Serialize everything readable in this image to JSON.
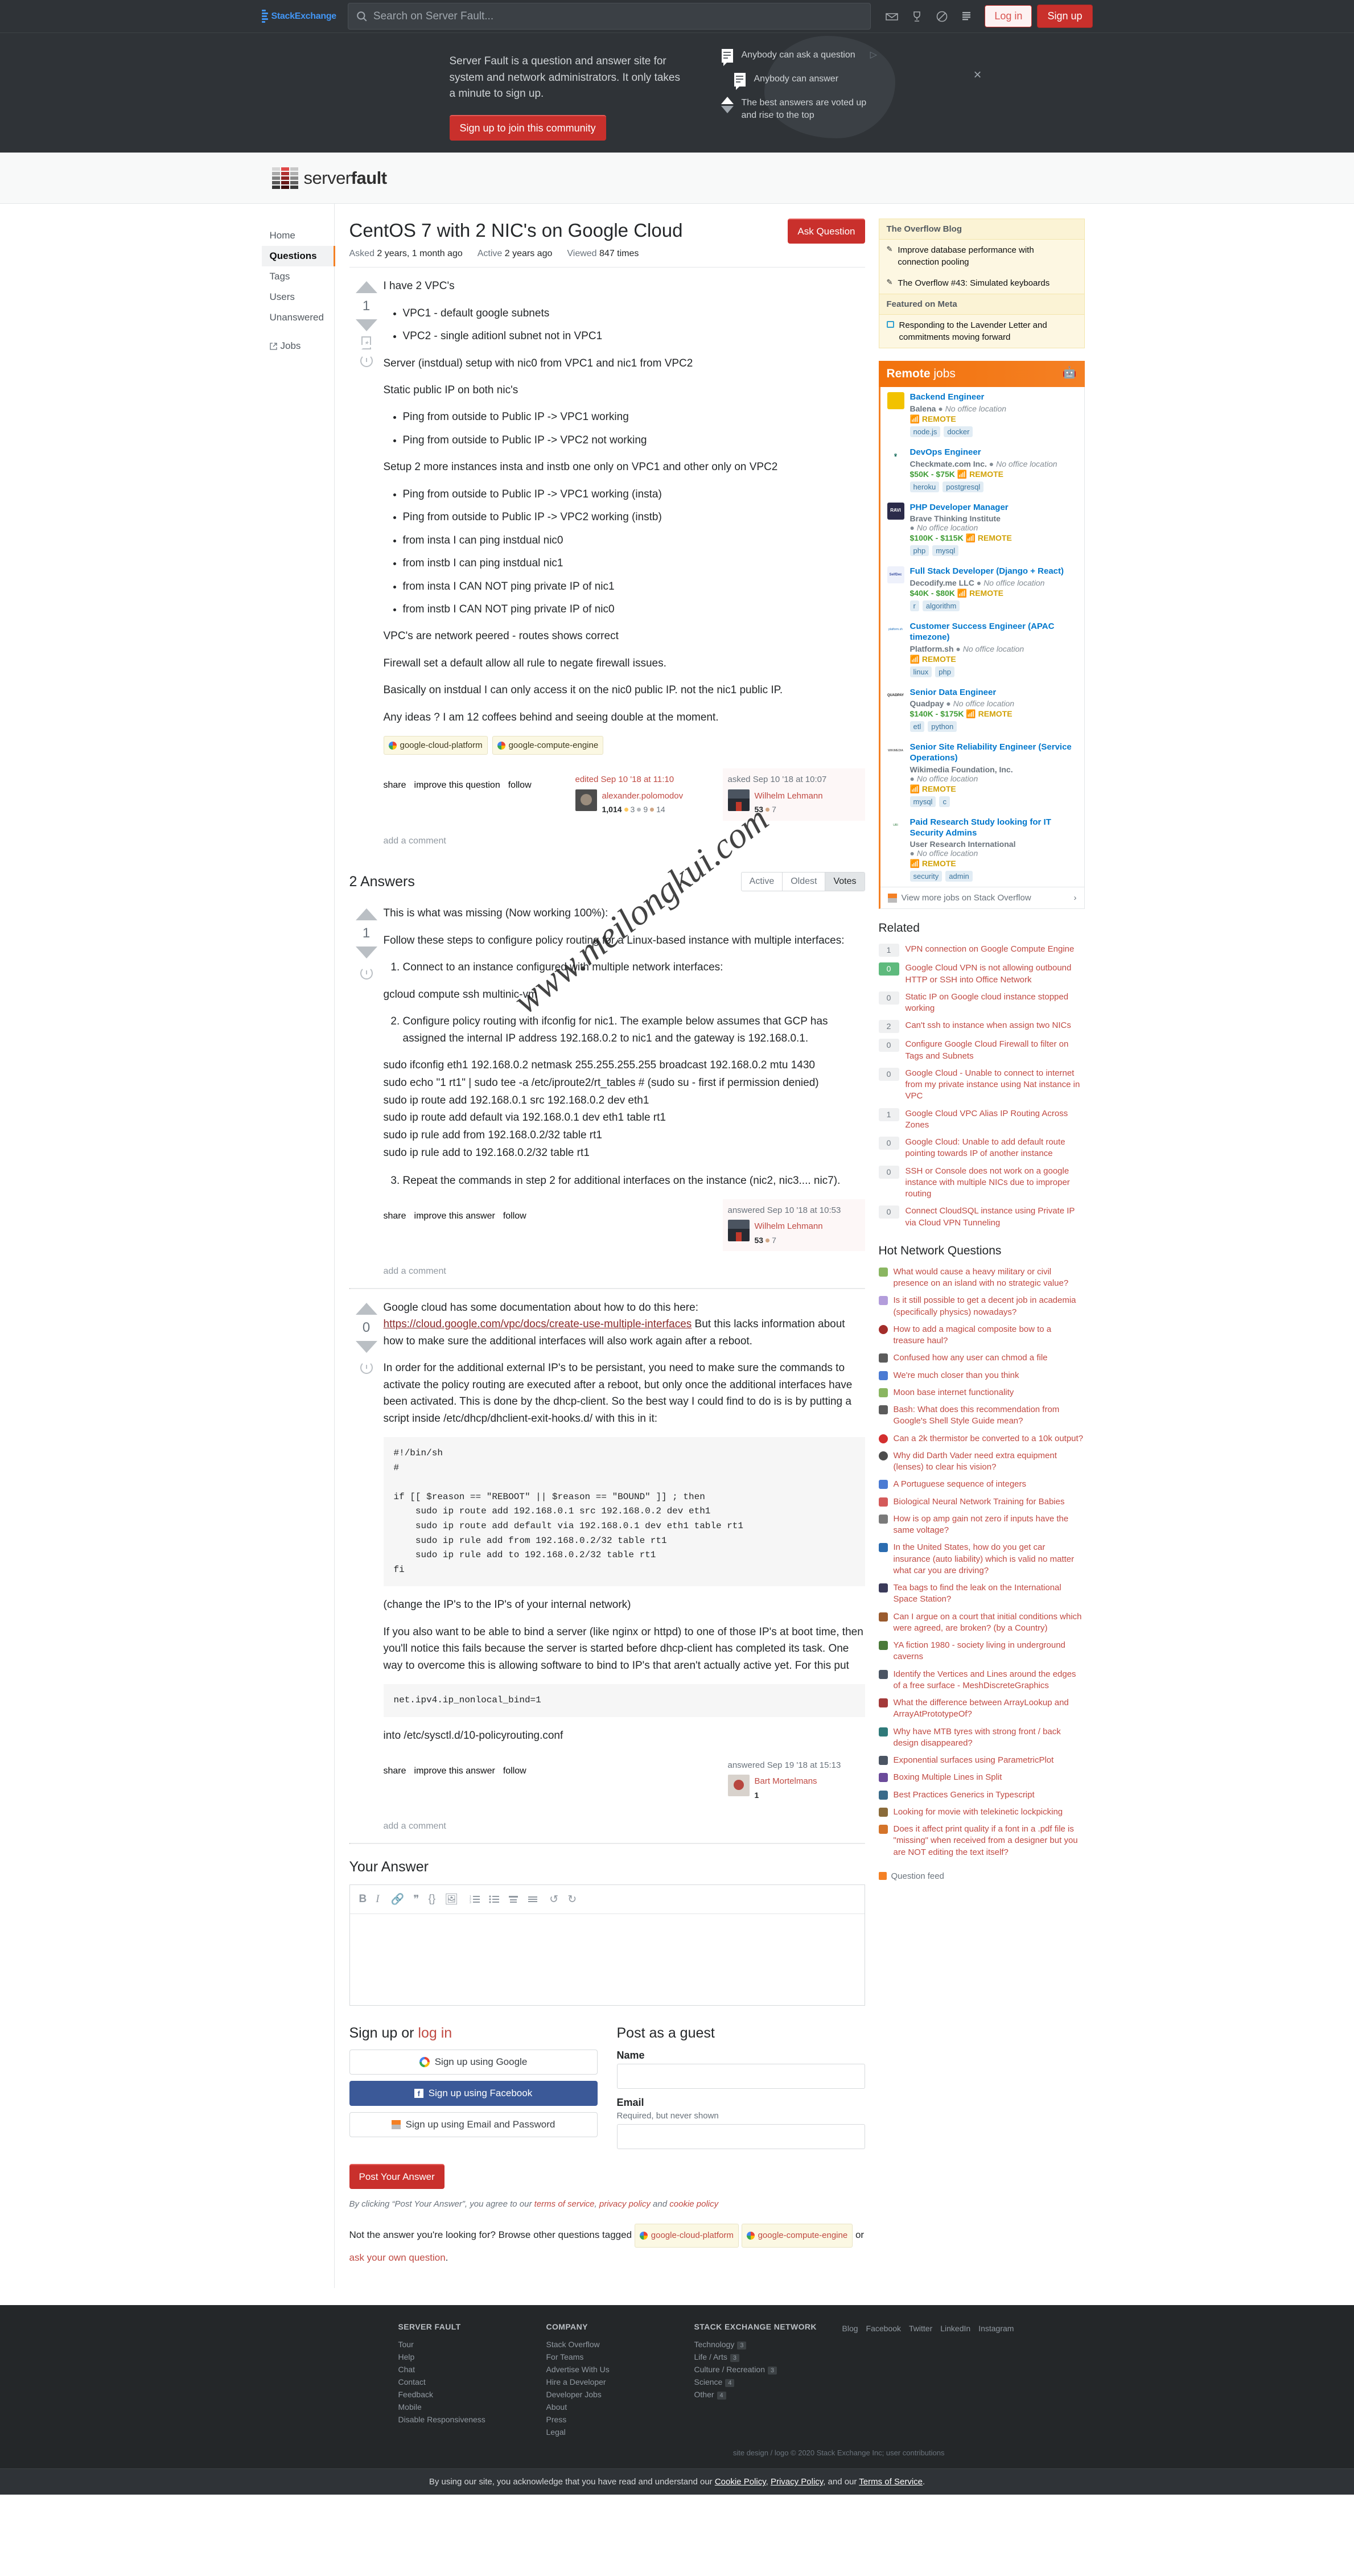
{
  "topbar": {
    "logo_primary": "Stack",
    "logo_secondary": "Exchange",
    "search_placeholder": "Search on Server Fault...",
    "login_label": "Log in",
    "signup_label": "Sign up",
    "icons": [
      "inbox-icon",
      "trophy-icon",
      "help-icon",
      "site-switcher-icon"
    ]
  },
  "hero": {
    "text": "Server Fault is a question and answer site for system and network administrators. It only takes a minute to sign up.",
    "button": "Sign up to join this community",
    "points": [
      "Anybody can ask a question",
      "Anybody can answer",
      "The best answers are voted up and rise to the top"
    ],
    "close": "×"
  },
  "siteheader": {
    "name_light": "server",
    "name_bold": "fault"
  },
  "leftnav": {
    "items": [
      "Home",
      "Questions",
      "Tags",
      "Users",
      "Unanswered"
    ],
    "selected": "Questions",
    "jobs": "Jobs"
  },
  "question": {
    "title": "CentOS 7 with 2 NIC's on Google Cloud",
    "ask_button": "Ask Question",
    "stats": [
      {
        "label": "Asked",
        "value": "2 years, 1 month ago"
      },
      {
        "label": "Active",
        "value": "2 years ago"
      },
      {
        "label": "Viewed",
        "value": "847 times"
      }
    ],
    "score": "1",
    "intro": "I have 2 VPC's",
    "list1": [
      "VPC1 - default google subnets",
      "VPC2 - single aditionl subnet not in VPC1"
    ],
    "p1": "Server (instdual) setup with nic0 from VPC1 and nic1 from VPC2",
    "p2": "Static public IP on both nic's",
    "list2": [
      "Ping from outside to Public IP -> VPC1 working",
      "Ping from outside to Public IP -> VPC2 not working"
    ],
    "p3": "Setup 2 more instances insta and instb one only on VPC1 and other only on VPC2",
    "list3": [
      "Ping from outside to Public IP -> VPC1 working (insta)",
      "Ping from outside to Public IP -> VPC2 working (instb)",
      "from insta I can ping instdual nic0",
      "from instb I can ping instdual nic1",
      "from insta I CAN NOT ping private IP of nic1",
      "from instb I CAN NOT ping private IP of nic0"
    ],
    "p4": "VPC's are network peered - routes shows correct",
    "p5": "Firewall set a default allow all rule to negate firewall issues.",
    "p6": "Basically on instdual I can only access it on the nic0 public IP. not the nic1 public IP.",
    "p7": "Any ideas ? I am 12 coffees behind and seeing double at the moment.",
    "tags": [
      "google-cloud-platform",
      "google-compute-engine"
    ],
    "actions": [
      "share",
      "improve this question",
      "follow"
    ],
    "editor": {
      "when": "edited Sep 10 '18 at 11:10",
      "name": "alexander.polomodov",
      "rep": "1,014",
      "gold": "3",
      "silver": "9",
      "bronze": "14"
    },
    "asker": {
      "when": "asked Sep 10 '18 at 10:07",
      "name": "Wilhelm Lehmann",
      "rep": "53",
      "bronze": "7"
    },
    "add_comment": "add a comment"
  },
  "answers_section": {
    "heading": "2 Answers",
    "sort": [
      "Active",
      "Oldest",
      "Votes"
    ],
    "sort_selected": "Votes"
  },
  "answer1": {
    "score": "1",
    "p1": "This is what was missing (Now working 100%):",
    "p2": "Follow these steps to configure policy routing for a Linux-based instance with multiple interfaces:",
    "step1": "Connect to an instance configured with multiple network interfaces:",
    "cmd1": "gcloud compute ssh multinic-vm",
    "step2": "Configure policy routing with ifconfig for nic1. The example below assumes that GCP has assigned the internal IP address 192.168.0.2 to nic1 and the gateway is 192.168.0.1.",
    "code": [
      "sudo ifconfig eth1 192.168.0.2 netmask 255.255.255.255 broadcast 192.168.0.2 mtu 1430",
      "sudo echo \"1 rt1\" | sudo tee -a /etc/iproute2/rt_tables # (sudo su - first if permission denied)",
      "sudo ip route add 192.168.0.1 src 192.168.0.2 dev eth1",
      "sudo ip route add default via 192.168.0.1 dev eth1 table rt1",
      "sudo ip rule add from 192.168.0.2/32 table rt1",
      "sudo ip rule add to 192.168.0.2/32 table rt1"
    ],
    "step3": "Repeat the commands in step 2 for additional interfaces on the instance (nic2, nic3.... nic7).",
    "actions": [
      "share",
      "improve this answer",
      "follow"
    ],
    "answerer": {
      "when": "answered Sep 10 '18 at 10:53",
      "name": "Wilhelm Lehmann",
      "rep": "53",
      "bronze": "7"
    },
    "add_comment": "add a comment"
  },
  "answer2": {
    "score": "0",
    "p1_before": "Google cloud has some documentation about how to do this here: ",
    "link": "https://cloud.google.com/vpc/docs/create-use-multiple-interfaces",
    "p1_after": " But this lacks information about how to make sure the additional interfaces will also work again after a reboot.",
    "p2": "In order for the additional external IP's to be persistant, you need to make sure the commands to activate the policy routing are executed after a reboot, but only once the additional interfaces have been activated. This is done by the dhcp-client. So the best way I could find to do is is by putting a script inside /etc/dhcp/dhclient-exit-hooks.d/ with this in it:",
    "code1": "#!/bin/sh\n#\n\nif [[ $reason == \"REBOOT\" || $reason == \"BOUND\" ]] ; then\n    sudo ip route add 192.168.0.1 src 192.168.0.2 dev eth1\n    sudo ip route add default via 192.168.0.1 dev eth1 table rt1\n    sudo ip rule add from 192.168.0.2/32 table rt1\n    sudo ip rule add to 192.168.0.2/32 table rt1\nfi",
    "p3": "(change the IP's to the IP's of your internal network)",
    "p4": "If you also want to be able to bind a server (like nginx or httpd) to one of those IP's at boot time, then you'll notice this fails because the server is started before dhcp-client has completed its task. One way to overcome this is allowing software to bind to IP's that aren't actually active yet. For this put",
    "code2": "net.ipv4.ip_nonlocal_bind=1",
    "p5": "into /etc/sysctl.d/10-policyrouting.conf",
    "actions": [
      "share",
      "improve this answer",
      "follow"
    ],
    "answerer": {
      "when": "answered Sep 19 '18 at 15:13",
      "name": "Bart Mortelmans",
      "rep": "1"
    },
    "add_comment": "add a comment"
  },
  "your_answer": {
    "heading": "Your Answer",
    "toolbar": [
      "bold-icon",
      "italic-icon",
      "link-icon",
      "blockquote-icon",
      "code-icon",
      "image-icon",
      "ordered-list-icon",
      "bullet-list-icon",
      "heading-icon",
      "horizontal-rule-icon",
      "undo-icon",
      "redo-icon"
    ],
    "signup_heading_a": "Sign up or ",
    "signup_heading_b": "log in",
    "oauth": [
      "Sign up using Google",
      "Sign up using Facebook",
      "Sign up using Email and Password"
    ],
    "guest_heading": "Post as a guest",
    "name_label": "Name",
    "email_label": "Email",
    "email_sub": "Required, but never shown",
    "post_button": "Post Your Answer",
    "legal_pre": "By clicking “Post Your Answer”, you agree to our ",
    "legal_links": [
      "terms of service",
      "privacy policy",
      "cookie policy"
    ],
    "not_answer": "Not the answer you're looking for? Browse other questions tagged",
    "not_answer_tags": [
      "google-cloud-platform",
      "google-compute-engine"
    ],
    "not_answer_or": "or ",
    "not_answer_ask": "ask your own question",
    "not_answer_end": "."
  },
  "sidebar": {
    "overflow_blog_heading": "The Overflow Blog",
    "overflow_blog_items": [
      "Improve database performance with connection pooling",
      "The Overflow #43: Simulated keyboards"
    ],
    "featured_meta_heading": "Featured on Meta",
    "featured_meta_items": [
      "Responding to the Lavender Letter and commitments moving forward"
    ],
    "jobs_heading_a": "Remote",
    "jobs_heading_b": " jobs",
    "jobs": [
      {
        "title": "Backend Engineer",
        "company": "Balena",
        "location": "No office location",
        "salary": "",
        "remote": "REMOTE",
        "tags": [
          "node.js",
          "docker"
        ],
        "logo_text": "",
        "logo_color": "#f2c200"
      },
      {
        "title": "DevOps Engineer",
        "company": "Checkmate.com Inc.",
        "location": "No office location",
        "salary": "$50K - $75K",
        "remote": "REMOTE",
        "tags": [
          "heroku",
          "postgresql"
        ],
        "logo_text": "itsCheckmate",
        "logo_color": "#ffffff"
      },
      {
        "title": "PHP Developer Manager",
        "company": "Brave Thinking Institute",
        "location": "No office location",
        "salary": "$100K - $115K",
        "remote": "REMOTE",
        "tags": [
          "php",
          "mysql"
        ],
        "logo_text": "RAVI",
        "logo_color": "#2b2b4a"
      },
      {
        "title": "Full Stack Developer (Django + React)",
        "company": "Decodify.me LLC",
        "location": "No office location",
        "salary": "$40K - $80K",
        "remote": "REMOTE",
        "tags": [
          "r",
          "algorithm"
        ],
        "logo_text": "SelfDec",
        "logo_color": "#eef1fb"
      },
      {
        "title": "Customer Success Engineer (APAC timezone)",
        "company": "Platform.sh",
        "location": "No office location",
        "salary": "",
        "remote": "REMOTE",
        "tags": [
          "linux",
          "php"
        ],
        "logo_text": "platform.sh",
        "logo_color": "#ffffff"
      },
      {
        "title": "Senior Data Engineer",
        "company": "Quadpay",
        "location": "No office location",
        "salary": "$140K - $175K",
        "remote": "REMOTE",
        "tags": [
          "etl",
          "python"
        ],
        "logo_text": "QUADPAY",
        "logo_color": "#ffffff"
      },
      {
        "title": "Senior Site Reliability Engineer (Service Operations)",
        "company": "Wikimedia Foundation, Inc.",
        "location": "No office location",
        "salary": "",
        "remote": "REMOTE",
        "tags": [
          "mysql",
          "c"
        ],
        "logo_text": "WIKIMEDIA",
        "logo_color": "#ffffff"
      },
      {
        "title": "Paid Research Study looking for IT Security Admins",
        "company": "User Research International",
        "location": "No office location",
        "salary": "",
        "remote": "REMOTE",
        "tags": [
          "security",
          "admin"
        ],
        "logo_text": "URI",
        "logo_color": "#ffffff"
      }
    ],
    "view_more_jobs": "View more jobs on Stack Overflow",
    "related_heading": "Related",
    "related": [
      {
        "score": "1",
        "highlight": false,
        "title": "VPN connection on Google Compute Engine"
      },
      {
        "score": "0",
        "highlight": true,
        "title": "Google Cloud VPN is not allowing outbound HTTP or SSH into Office Network"
      },
      {
        "score": "0",
        "highlight": false,
        "title": "Static IP on Google cloud instance stopped working"
      },
      {
        "score": "2",
        "highlight": false,
        "title": "Can't ssh to instance when assign two NICs"
      },
      {
        "score": "0",
        "highlight": false,
        "title": "Configure Google Cloud Firewall to filter on Tags and Subnets"
      },
      {
        "score": "0",
        "highlight": false,
        "title": "Google Cloud - Unable to connect to internet from my private instance using Nat instance in VPC"
      },
      {
        "score": "1",
        "highlight": false,
        "title": "Google Cloud VPC Alias IP Routing Across Zones"
      },
      {
        "score": "0",
        "highlight": false,
        "title": "Google Cloud: Unable to add default route pointing towards IP of another instance"
      },
      {
        "score": "0",
        "highlight": false,
        "title": "SSH or Console does not work on a google instance with multiple NICs due to improper routing"
      },
      {
        "score": "0",
        "highlight": false,
        "title": "Connect CloudSQL instance using Private IP via Cloud VPN Tunneling"
      }
    ],
    "hot_heading": "Hot Network Questions",
    "hot": [
      {
        "site": "worldbuilding",
        "color": "#8ab661",
        "title": "What would cause a heavy military or civil presence on an island with no strategic value?"
      },
      {
        "site": "academia",
        "color": "#b39ddb",
        "title": "Is it still possible to get a decent job in academia (specifically physics) nowadays?"
      },
      {
        "site": "rpg",
        "color": "#a32d2a",
        "title": "How to add a magical composite bow to a treasure haul?"
      },
      {
        "site": "unix",
        "color": "#5b5b5b",
        "title": "Confused how any user can chmod a file"
      },
      {
        "site": "puzzling",
        "color": "#4b7bd3",
        "title": "We're much closer than you think"
      },
      {
        "site": "worldbuilding",
        "color": "#8ab661",
        "title": "Moon base internet functionality"
      },
      {
        "site": "unix",
        "color": "#5b5b5b",
        "title": "Bash: What does this recommendation from Google's Shell Style Guide mean?"
      },
      {
        "site": "electronics",
        "color": "#d32f2f",
        "title": "Can a 2k thermistor be converted to a 10k output?"
      },
      {
        "site": "scifi",
        "color": "#4d4d4d",
        "title": "Why did Darth Vader need extra equipment (lenses) to clear his vision?"
      },
      {
        "site": "puzzling",
        "color": "#4b7bd3",
        "title": "A Portuguese sequence of integers"
      },
      {
        "site": "biology",
        "color": "#d45a5a",
        "title": "Biological Neural Network Training for Babies"
      },
      {
        "site": "mechanics",
        "color": "#7a7a7a",
        "title": "How is op amp gain not zero if inputs have the same voltage?"
      },
      {
        "site": "travel",
        "color": "#2b6cb0",
        "title": "In the United States, how do you get car insurance (auto liability) which is valid no matter what car you are driving?"
      },
      {
        "site": "spaceexploration",
        "color": "#3a3a5a",
        "title": "Tea bags to find the leak on the International Space Station?"
      },
      {
        "site": "law",
        "color": "#9a5b2e",
        "title": "Can I argue on a court that initial conditions which were agreed, are broken? (by a Country)"
      },
      {
        "site": "retrocomputing",
        "color": "#4a7a3a",
        "title": "YA fiction 1980 - society living in underground caverns"
      },
      {
        "site": "math",
        "color": "#4b5563",
        "title": "Identify the Vertices and Lines around the edges of a free surface - MeshDiscreteGraphics"
      },
      {
        "site": "mathematica",
        "color": "#a33a3a",
        "title": "What the difference between ArrayLookup and ArrayAtPrototypeOf?"
      },
      {
        "site": "bicycles",
        "color": "#2f7a7a",
        "title": "Why have MTB tyres with strong front / back design disappeared?"
      },
      {
        "site": "math",
        "color": "#4b5563",
        "title": "Exponential surfaces using ParametricPlot"
      },
      {
        "site": "codegolf",
        "color": "#6b4b9a",
        "title": "Boxing Multiple Lines in Split"
      },
      {
        "site": "softwareengineering",
        "color": "#3a6b8a",
        "title": "Best Practices Generics in Typescript"
      },
      {
        "site": "lockpicking",
        "color": "#8a6b3a",
        "title": "Looking for movie with telekinetic lockpicking"
      },
      {
        "site": "writing",
        "color": "#d4742a",
        "title": "Does it affect print quality if a font in a .pdf file is \"missing\" when received from a designer but you are NOT editing the text itself?"
      }
    ],
    "question_feed": "Question feed"
  },
  "footer": {
    "columns": [
      {
        "heading": "SERVER FAULT",
        "links": [
          "Tour",
          "Help",
          "Chat",
          "Contact",
          "Feedback",
          "Mobile",
          "Disable Responsiveness"
        ]
      },
      {
        "heading": "COMPANY",
        "links": [
          "Stack Overflow",
          "For Teams",
          "Advertise With Us",
          "Hire a Developer",
          "Developer Jobs",
          "About",
          "Press",
          "Legal"
        ]
      }
    ],
    "network_heading": "STACK EXCHANGE NETWORK",
    "network": [
      {
        "name": "Technology",
        "count": "3"
      },
      {
        "name": "Life / Arts",
        "count": "3"
      },
      {
        "name": "Culture / Recreation",
        "count": "3"
      },
      {
        "name": "Science",
        "count": "4"
      },
      {
        "name": "Other",
        "count": "4"
      }
    ],
    "social": [
      "Blog",
      "Facebook",
      "Twitter",
      "LinkedIn",
      "Instagram"
    ],
    "copyright": "site design / logo © 2020 Stack Exchange Inc; user contributions"
  },
  "cookiebar": {
    "text_pre": "By using our site, you acknowledge that you have read and understand our ",
    "links": [
      "Cookie Policy",
      "Privacy Policy",
      "Terms of Service"
    ],
    "text_mid": ", and our ",
    "text_end": "."
  },
  "watermark": {
    "text": "www.meilongkui.com"
  }
}
